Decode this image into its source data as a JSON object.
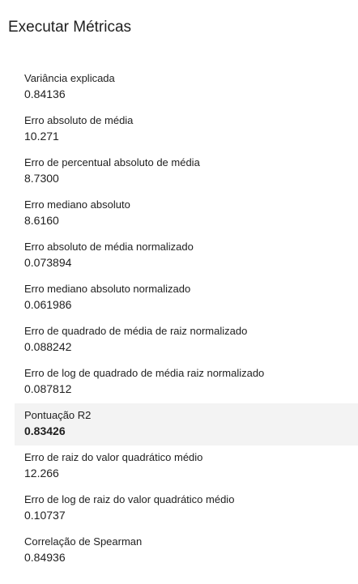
{
  "panel": {
    "title": "Executar Métricas"
  },
  "metrics": [
    {
      "label": "Variância explicada",
      "value": "0.84136"
    },
    {
      "label": "Erro absoluto de média",
      "value": "10.271"
    },
    {
      "label": "Erro de percentual absoluto de média",
      "value": "8.7300"
    },
    {
      "label": "Erro mediano absoluto",
      "value": "8.6160"
    },
    {
      "label": "Erro absoluto de média normalizado",
      "value": "0.073894"
    },
    {
      "label": "Erro mediano absoluto normalizado",
      "value": "0.061986"
    },
    {
      "label": "Erro de quadrado de média de raiz normalizado",
      "value": "0.088242"
    },
    {
      "label": "Erro de log de quadrado de média raiz normalizado",
      "value": "0.087812"
    },
    {
      "label": "Pontuação R2",
      "value": "0.83426"
    },
    {
      "label": "Erro de raiz do valor quadrático médio",
      "value": "12.266"
    },
    {
      "label": "Erro de log de raiz do valor quadrático médio",
      "value": "0.10737"
    },
    {
      "label": "Correlação de Spearman",
      "value": "0.84936"
    }
  ],
  "colors": {
    "text": "#1f1f1f",
    "hover_background": "#f3f3f3",
    "background": "#ffffff"
  }
}
